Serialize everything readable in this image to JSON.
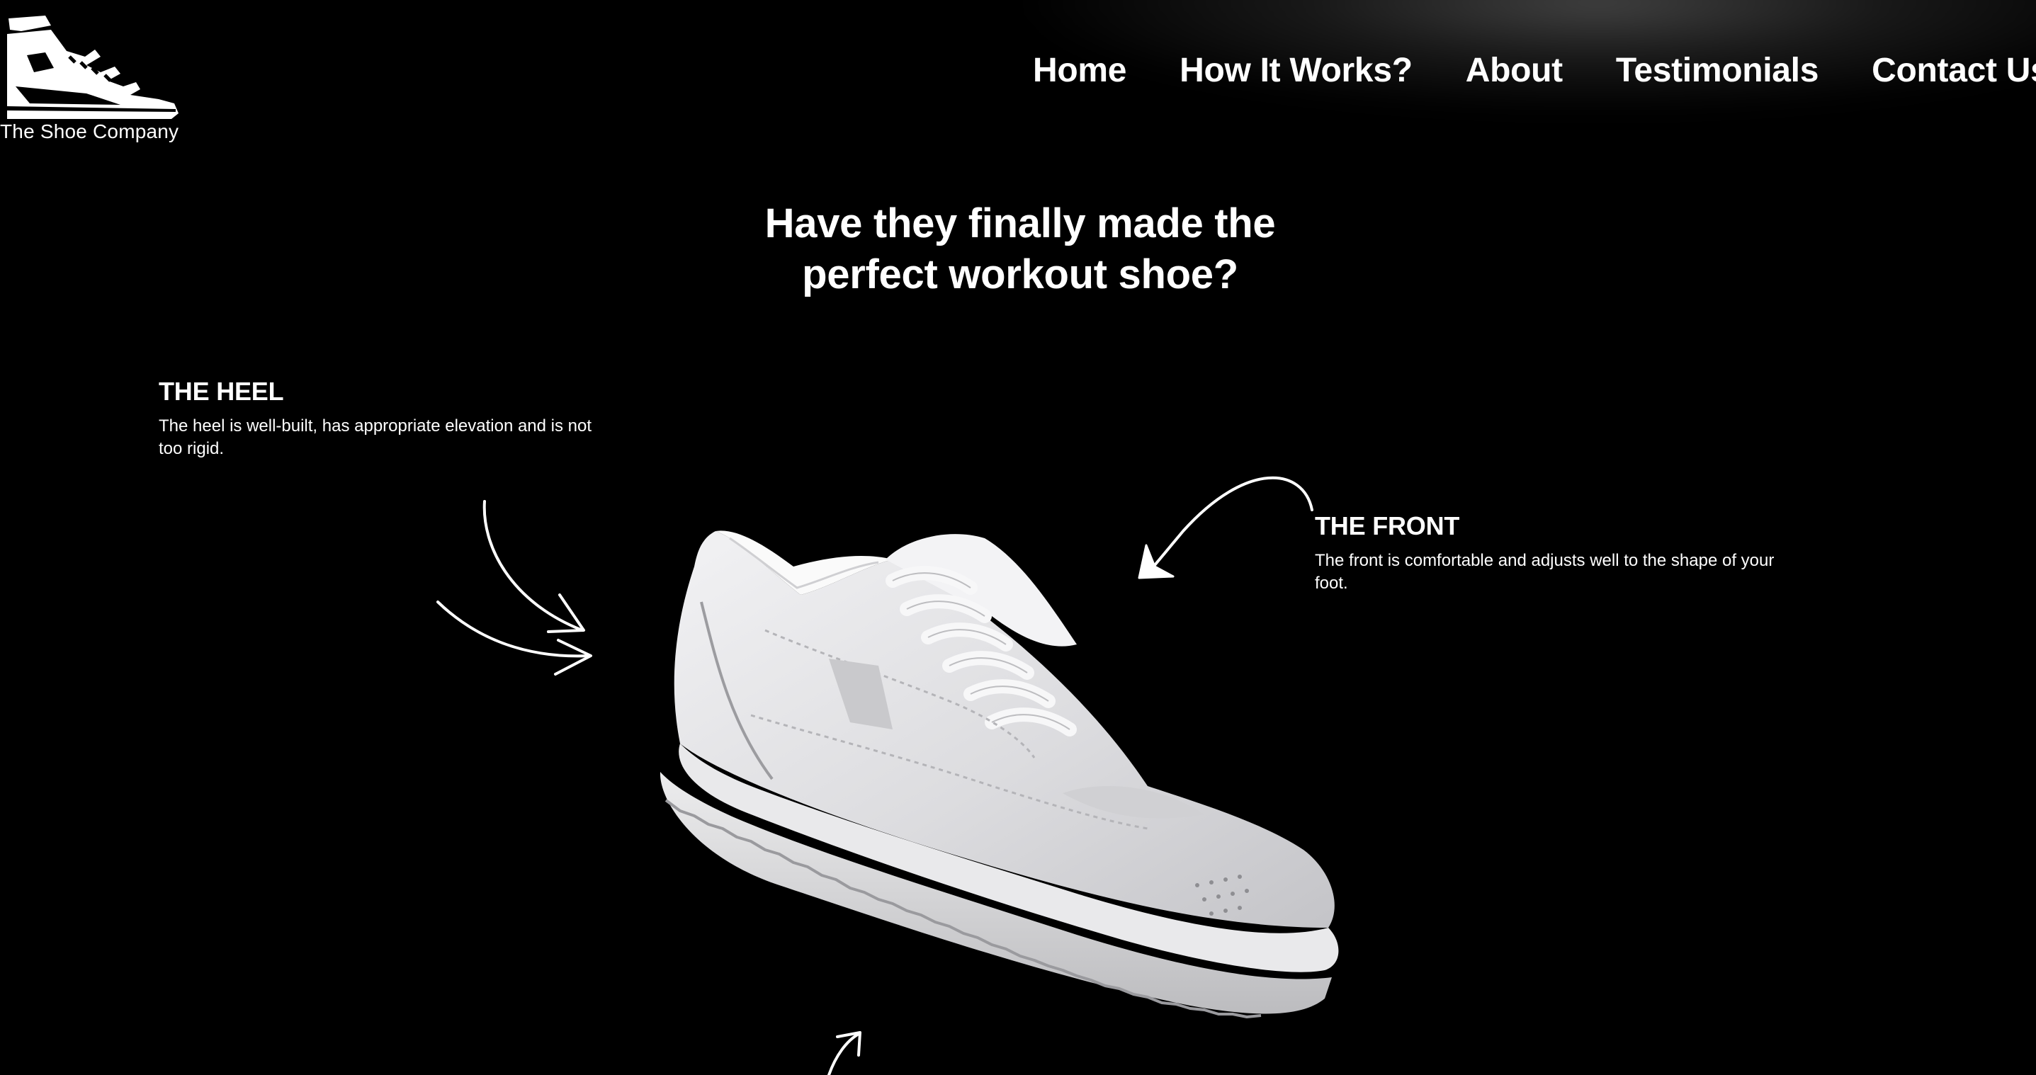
{
  "brand": {
    "name": "The Shoe Company",
    "logo_icon": "sneaker-logo-icon"
  },
  "nav": {
    "items": [
      {
        "label": "Home"
      },
      {
        "label": "How It Works?"
      },
      {
        "label": "About"
      },
      {
        "label": "Testimonials"
      },
      {
        "label": "Contact Us"
      }
    ]
  },
  "hero": {
    "headline_line1": "Have they finally made the",
    "headline_line2": "perfect workout shoe?"
  },
  "features": {
    "heel": {
      "title": "THE HEEL",
      "description": "The heel is well-built, has appropriate elevation and is not too rigid."
    },
    "front": {
      "title": "THE FRONT",
      "description": "The front is comfortable and adjusts well to the shape of your foot."
    }
  },
  "colors": {
    "background": "#000000",
    "text": "#ffffff",
    "shoe": "#e6e6e8"
  },
  "icons": {
    "heel_arrow": "hand-drawn-arrow-icon",
    "front_arrow": "hand-drawn-arrow-icon",
    "bottom_arrow": "hand-drawn-arrow-icon"
  }
}
